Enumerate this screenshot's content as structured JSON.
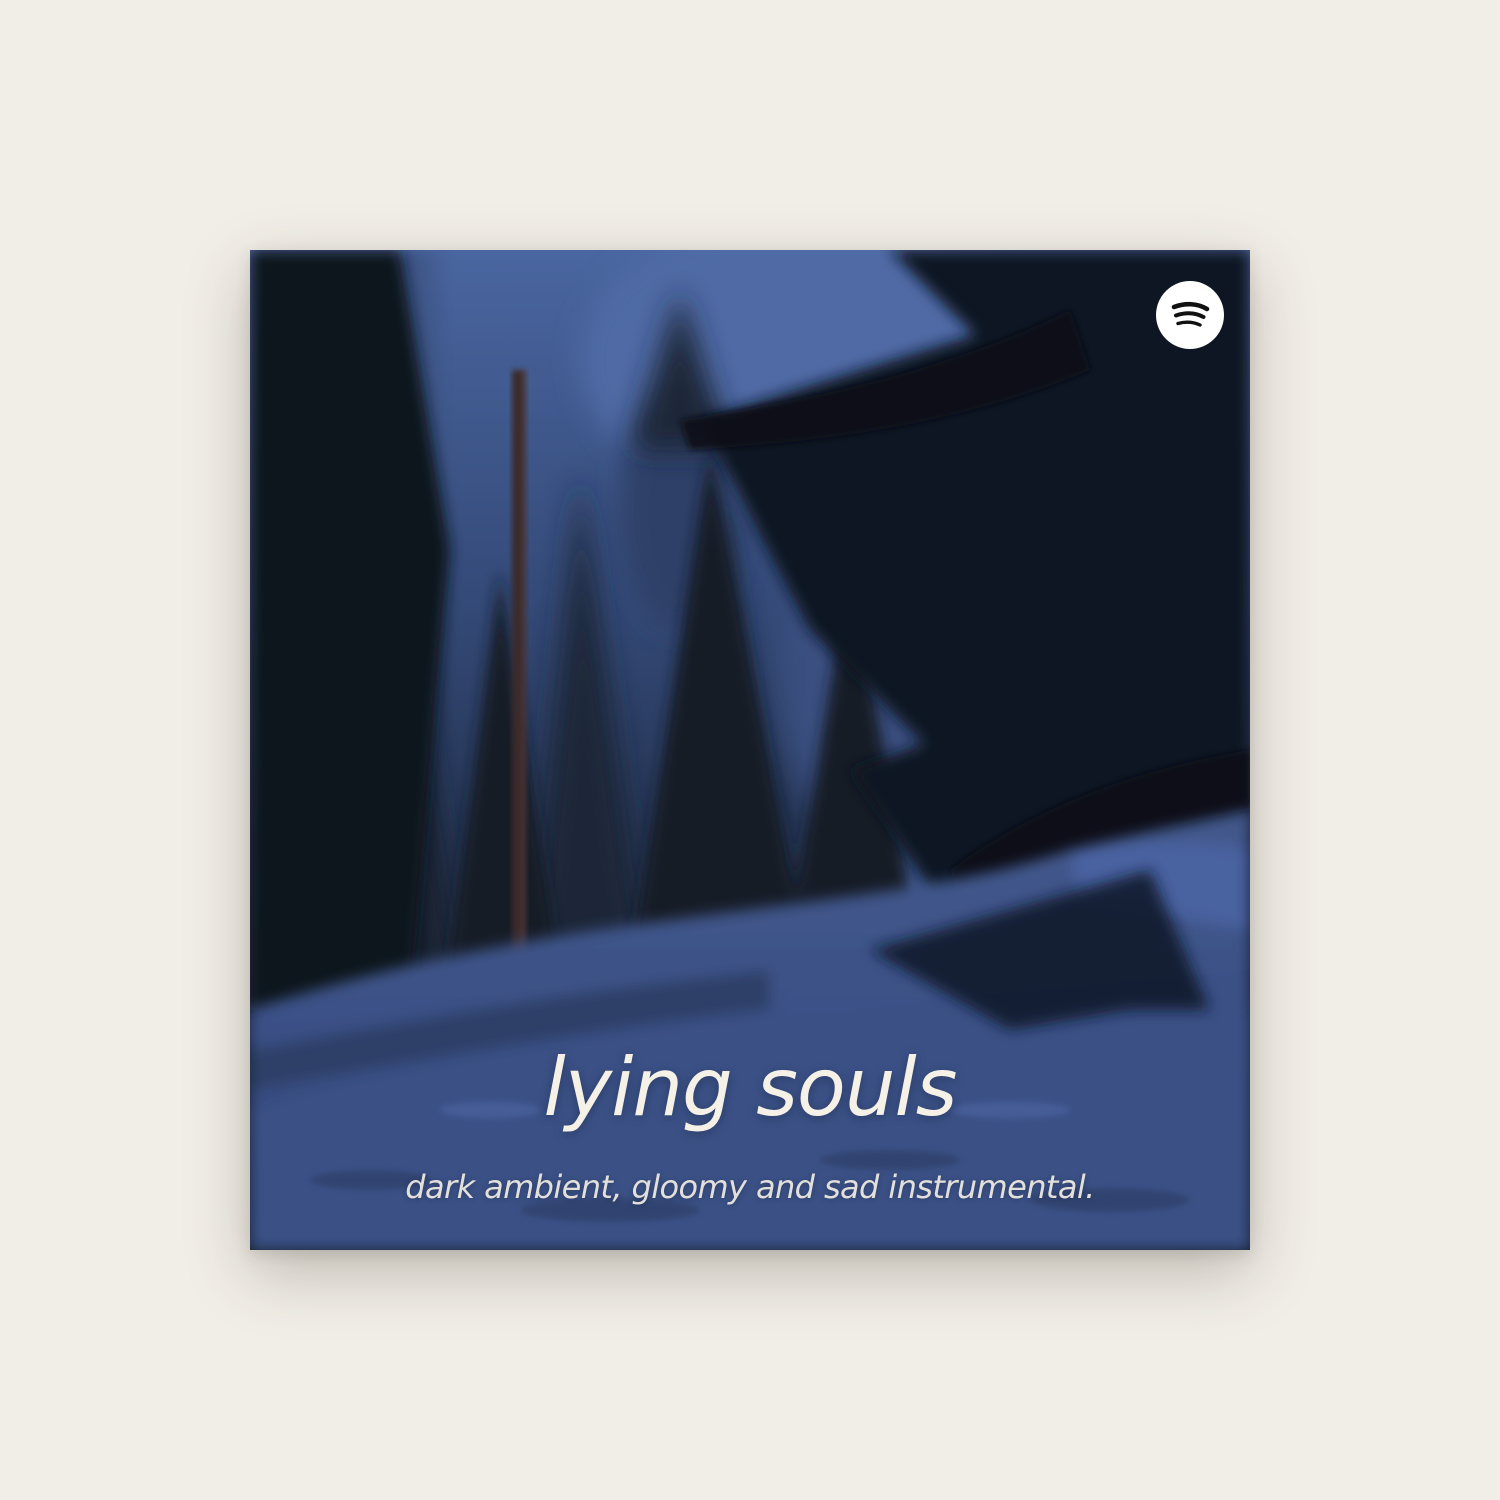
{
  "cover": {
    "title": "lying souls",
    "subtitle": "dark ambient, gloomy and sad instrumental.",
    "badge_icon": "spotify-logo-icon",
    "background_color": "#f1eee7",
    "text_color": "#f6f1e6",
    "sky_color": "#3f5a8c",
    "snow_color": "#3e5488"
  }
}
